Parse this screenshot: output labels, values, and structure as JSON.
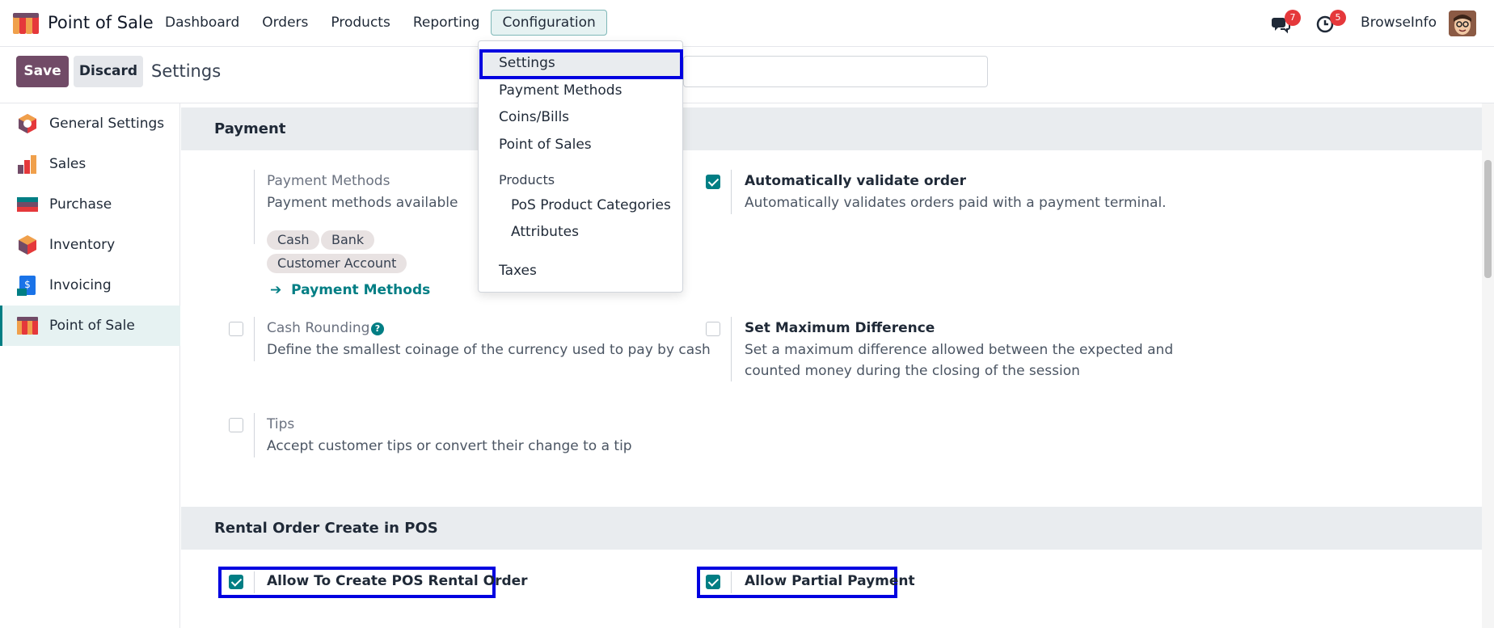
{
  "app": {
    "name": "Point of Sale"
  },
  "nav": {
    "items": [
      {
        "label": "Dashboard"
      },
      {
        "label": "Orders"
      },
      {
        "label": "Products"
      },
      {
        "label": "Reporting"
      },
      {
        "label": "Configuration"
      }
    ]
  },
  "systray": {
    "messages_count": "7",
    "activities_count": "5",
    "user_name": "BrowseInfo"
  },
  "control_panel": {
    "save_label": "Save",
    "discard_label": "Discard",
    "title": "Settings",
    "search_placeholder": ""
  },
  "sidebar": {
    "items": [
      {
        "label": "General Settings"
      },
      {
        "label": "Sales"
      },
      {
        "label": "Purchase"
      },
      {
        "label": "Inventory"
      },
      {
        "label": "Invoicing"
      },
      {
        "label": "Point of Sale"
      }
    ]
  },
  "payment_section": {
    "title": "Payment",
    "payment_methods": {
      "title": "Payment Methods",
      "desc": "Payment methods available",
      "tags": [
        "Cash",
        "Bank",
        "Customer Account"
      ],
      "link": "Payment Methods",
      "link_arrow": "➔"
    },
    "auto_validate": {
      "title": "Automatically validate order",
      "desc": "Automatically validates orders paid with a payment terminal.",
      "checked": true
    },
    "cash_rounding": {
      "title": "Cash Rounding",
      "help": "?",
      "desc": "Define the smallest coinage of the currency used to pay by cash",
      "checked": false
    },
    "max_difference": {
      "title": "Set Maximum Difference",
      "desc_line1": "Set a maximum difference allowed between the expected and",
      "desc_line2": "counted money during the closing of the session",
      "checked": false
    },
    "tips": {
      "title": "Tips",
      "desc": "Accept customer tips or convert their change to a tip",
      "checked": false
    }
  },
  "rental_section": {
    "title": "Rental Order Create in POS",
    "allow_create": {
      "title": "Allow To Create POS Rental Order",
      "checked": true
    },
    "allow_partial": {
      "title": "Allow Partial Payment",
      "checked": true
    }
  },
  "config_dropdown": {
    "items": [
      "Settings",
      "Payment Methods",
      "Coins/Bills",
      "Point of Sales"
    ],
    "products_header": "Products",
    "product_items": [
      "PoS Product Categories",
      "Attributes"
    ],
    "taxes": "Taxes"
  },
  "colors": {
    "brand": "#714b67",
    "accent": "#017e84",
    "highlight": "#0000e0",
    "badge": "#e5383b"
  }
}
